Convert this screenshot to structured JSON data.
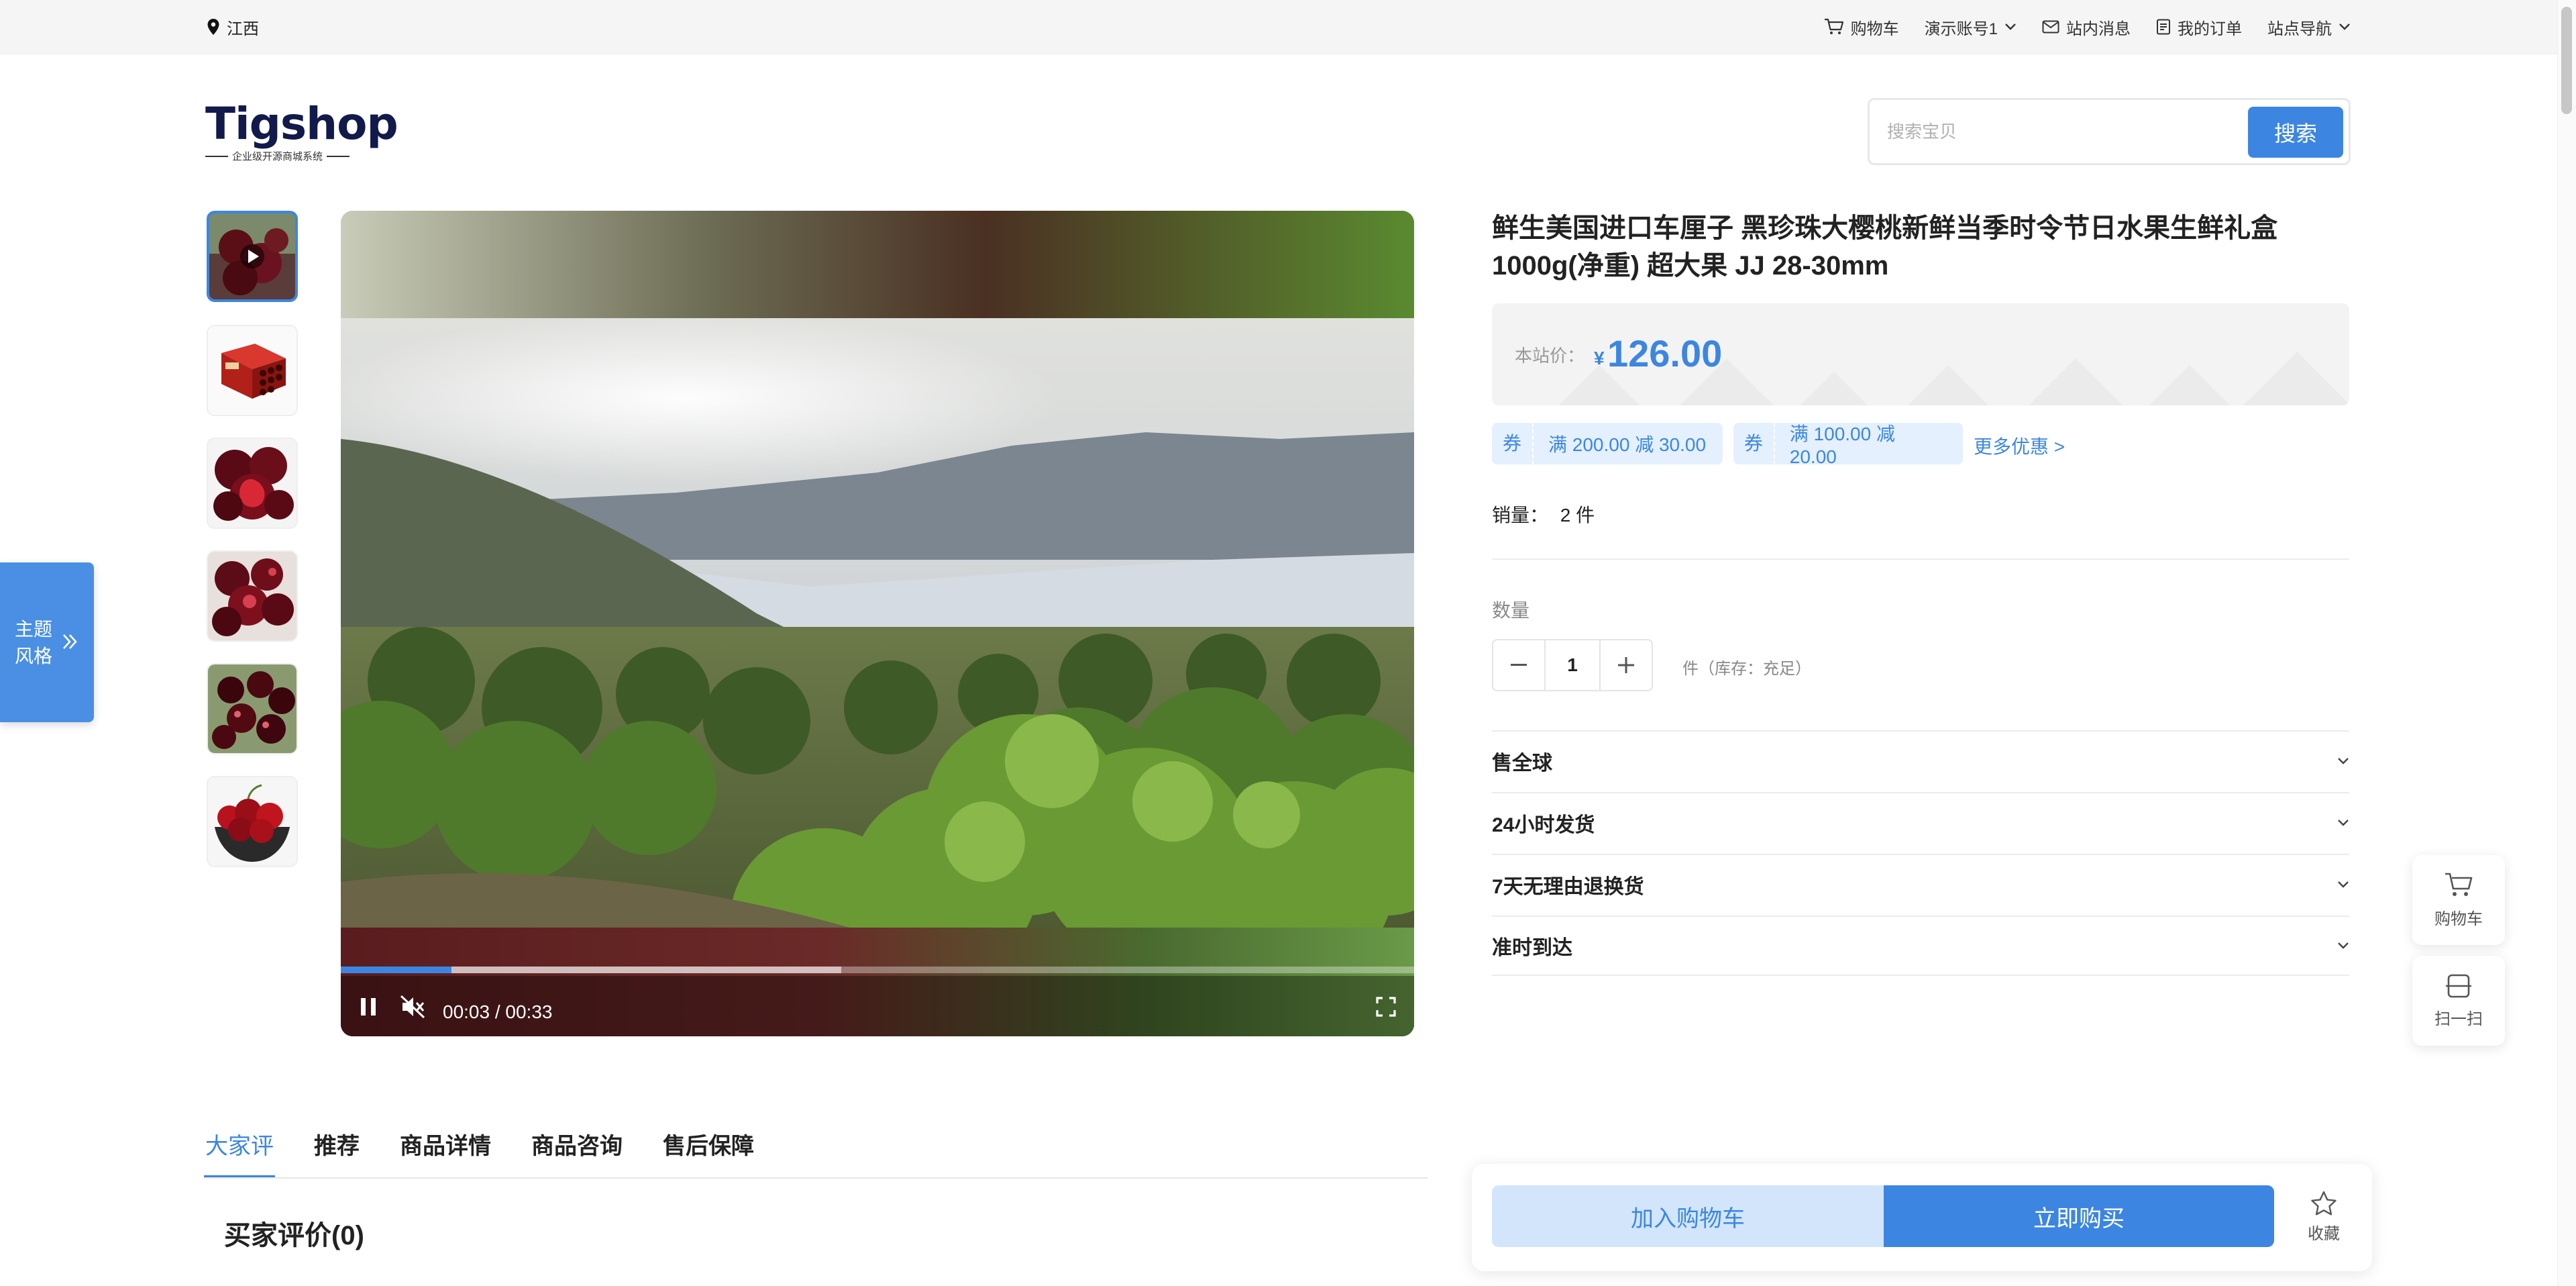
{
  "topbar": {
    "location": "江西",
    "nav": {
      "cart": "购物车",
      "account": "演示账号1",
      "messages": "站内消息",
      "orders": "我的订单",
      "site_nav": "站点导航"
    }
  },
  "logo": {
    "text": "Tigshop",
    "tagline": "企业级开源商城系统"
  },
  "search": {
    "placeholder": "搜索宝贝",
    "button": "搜索"
  },
  "video": {
    "current_time": "00:03",
    "duration": "00:33",
    "time_display": "00:03 / 00:33",
    "progress": 0.103,
    "buffered": 0.466
  },
  "product": {
    "title": "鲜生美国进口车厘子 黑珍珠大樱桃新鲜当季时令节日水果生鲜礼盒1000g(净重) 超大果 JJ 28-30mm",
    "price_label": "本站价：",
    "currency": "¥",
    "price": "126.00",
    "coupons": [
      {
        "tag": "券",
        "text": "满 200.00 减 30.00"
      },
      {
        "tag": "券",
        "text": "满 100.00 减 20.00"
      }
    ],
    "more_deals": "更多优惠 >",
    "sales_label": "销量：",
    "sales_value": "2 件",
    "qty_label": "数量",
    "qty": "1",
    "stock": "件（库存：充足）",
    "services": [
      "售全球",
      "24小时发货",
      "7天无理由退换货",
      "准时到达"
    ]
  },
  "side": {
    "theme": "主题风格",
    "theme_line1": "主题",
    "theme_line2": "风格",
    "cart": "购物车",
    "scan": "扫一扫"
  },
  "tabs": [
    "大家评",
    "推荐",
    "商品详情",
    "商品咨询",
    "售后保障"
  ],
  "reviews_title": "买家评价(0)",
  "buybar": {
    "add_cart": "加入购物车",
    "buy_now": "立即购买",
    "favorite": "收藏"
  },
  "colors": {
    "accent": "#3c86e2",
    "accent_light": "#d2e5fb",
    "coupon_bg": "#e4f0fd",
    "logo_navy": "#111a4a"
  }
}
